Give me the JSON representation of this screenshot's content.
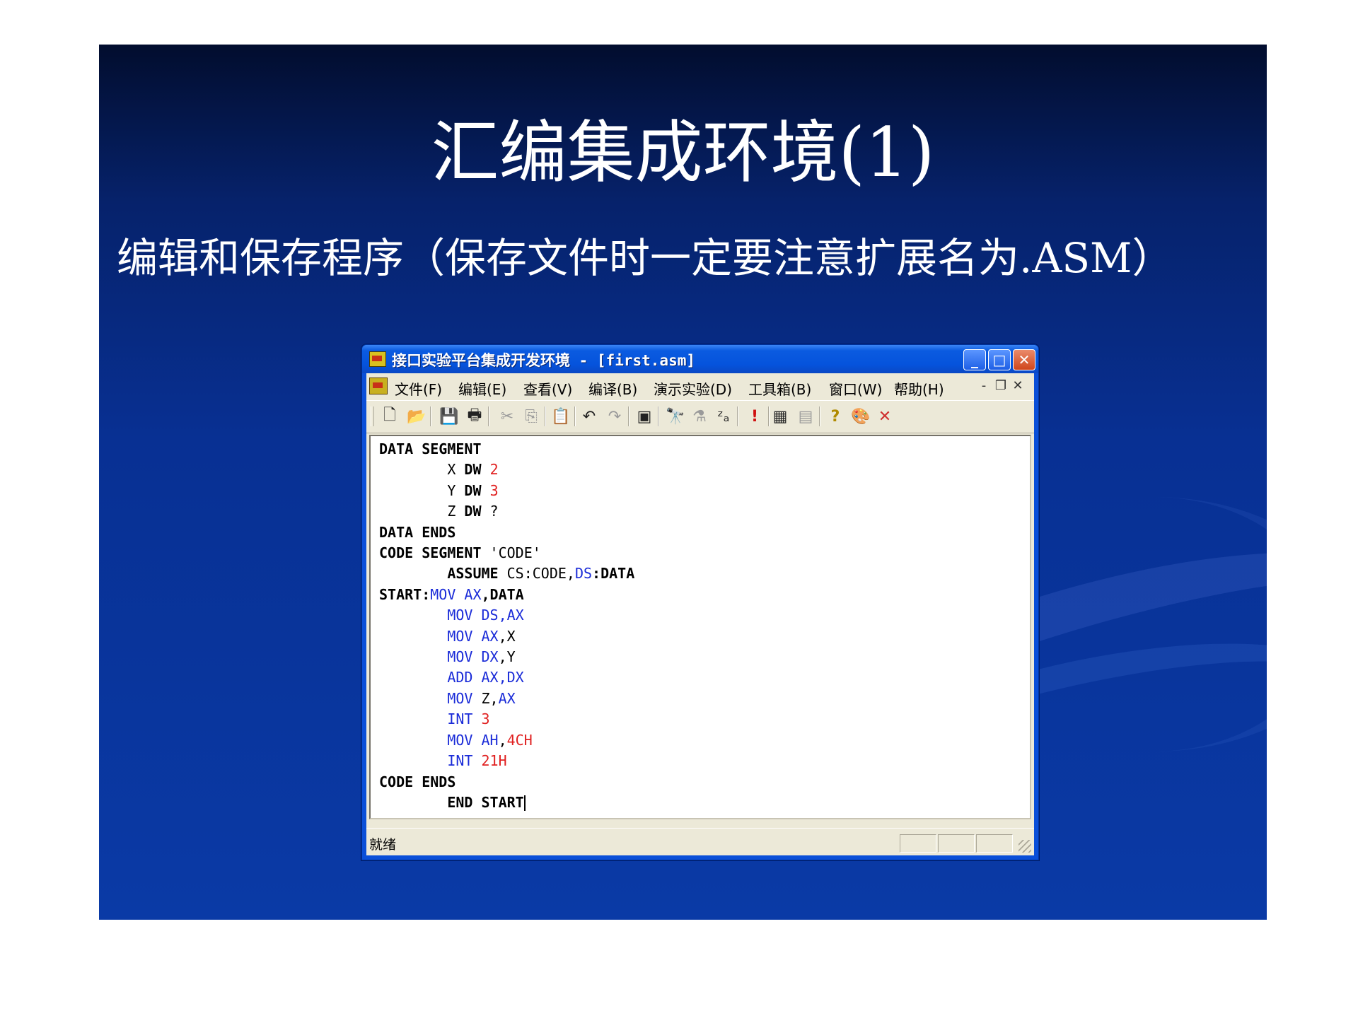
{
  "slide": {
    "title": "汇编集成环境(1)",
    "subtitle": "编辑和保存程序（保存文件时一定要注意扩展名为.ASM）"
  },
  "window": {
    "title": "接口实验平台集成开发环境 - [first.asm]",
    "controls": {
      "minimize": "_",
      "maximize": "□",
      "close": "✕"
    }
  },
  "menubar": {
    "items": [
      "文件(F)",
      "编辑(E)",
      "查看(V)",
      "编译(B)",
      "演示实验(D)",
      "工具箱(B)",
      "窗口(W)",
      "帮助(H)"
    ],
    "mdi_controls": {
      "minimize": "-",
      "restore": "❐",
      "close": "✕"
    }
  },
  "toolbar": {
    "buttons": [
      {
        "name": "new-file-icon",
        "glyph": "🗋",
        "enabled": true
      },
      {
        "name": "open-folder-icon",
        "glyph": "📂",
        "enabled": true
      },
      {
        "name": "save-icon",
        "glyph": "💾",
        "enabled": true
      },
      {
        "name": "print-icon",
        "glyph": "🖶",
        "enabled": true
      },
      {
        "name": "cut-icon",
        "glyph": "✂",
        "enabled": false
      },
      {
        "name": "copy-icon",
        "glyph": "⎘",
        "enabled": false
      },
      {
        "name": "paste-icon",
        "glyph": "📋",
        "enabled": true
      },
      {
        "name": "undo-icon",
        "glyph": "↶",
        "enabled": true
      },
      {
        "name": "redo-icon",
        "glyph": "↷",
        "enabled": false
      },
      {
        "name": "edit-window-icon",
        "glyph": "▣",
        "enabled": true
      },
      {
        "name": "find-binoculars-icon",
        "glyph": "🔭",
        "enabled": true
      },
      {
        "name": "replace-icon",
        "glyph": "⚗",
        "enabled": false
      },
      {
        "name": "sort-az-icon",
        "glyph": "ᶻₐ",
        "enabled": true
      },
      {
        "name": "run-exclamation-icon",
        "glyph": "!",
        "enabled": true
      },
      {
        "name": "debug-memory-icon",
        "glyph": "▦",
        "enabled": true
      },
      {
        "name": "list-icon",
        "glyph": "▤",
        "enabled": false
      },
      {
        "name": "help-icon",
        "glyph": "?",
        "enabled": true
      },
      {
        "name": "color-palette-icon",
        "glyph": "🎨",
        "enabled": true
      },
      {
        "name": "close-x-icon",
        "glyph": "✕",
        "enabled": true
      }
    ]
  },
  "editor": {
    "lines": [
      [
        {
          "t": "DATA SEGMENT",
          "c": "kw"
        }
      ],
      [
        {
          "t": "        X ",
          "c": ""
        },
        {
          "t": "DW",
          "c": "kw"
        },
        {
          "t": " ",
          "c": ""
        },
        {
          "t": "2",
          "c": "red"
        }
      ],
      [
        {
          "t": "        Y ",
          "c": ""
        },
        {
          "t": "DW",
          "c": "kw"
        },
        {
          "t": " ",
          "c": ""
        },
        {
          "t": "3",
          "c": "red"
        }
      ],
      [
        {
          "t": "        Z ",
          "c": ""
        },
        {
          "t": "DW",
          "c": "kw"
        },
        {
          "t": " ?",
          "c": ""
        }
      ],
      [
        {
          "t": "DATA ENDS",
          "c": "kw"
        }
      ],
      [
        {
          "t": "CODE SEGMENT ",
          "c": "kw"
        },
        {
          "t": "'CODE'",
          "c": ""
        }
      ],
      [
        {
          "t": "        ",
          "c": ""
        },
        {
          "t": "ASSUME",
          "c": "kw"
        },
        {
          "t": " CS:CODE,",
          "c": ""
        },
        {
          "t": "DS",
          "c": "blue"
        },
        {
          "t": ":DATA",
          "c": "kw"
        }
      ],
      [
        {
          "t": "START:",
          "c": "kw"
        },
        {
          "t": "MOV AX",
          "c": "blue"
        },
        {
          "t": ",DATA",
          "c": "kw"
        }
      ],
      [
        {
          "t": "        ",
          "c": ""
        },
        {
          "t": "MOV DS,AX",
          "c": "blue"
        }
      ],
      [
        {
          "t": "        ",
          "c": ""
        },
        {
          "t": "MOV AX",
          "c": "blue"
        },
        {
          "t": ",X",
          "c": ""
        }
      ],
      [
        {
          "t": "        ",
          "c": ""
        },
        {
          "t": "MOV DX",
          "c": "blue"
        },
        {
          "t": ",Y",
          "c": ""
        }
      ],
      [
        {
          "t": "        ",
          "c": ""
        },
        {
          "t": "ADD AX,DX",
          "c": "blue"
        }
      ],
      [
        {
          "t": "        ",
          "c": ""
        },
        {
          "t": "MOV",
          "c": "blue"
        },
        {
          "t": " Z,",
          "c": ""
        },
        {
          "t": "AX",
          "c": "blue"
        }
      ],
      [
        {
          "t": "        ",
          "c": ""
        },
        {
          "t": "INT",
          "c": "blue"
        },
        {
          "t": " ",
          "c": ""
        },
        {
          "t": "3",
          "c": "red"
        }
      ],
      [
        {
          "t": "        ",
          "c": ""
        },
        {
          "t": "MOV AH",
          "c": "blue"
        },
        {
          "t": ",",
          "c": ""
        },
        {
          "t": "4CH",
          "c": "red"
        }
      ],
      [
        {
          "t": "        ",
          "c": ""
        },
        {
          "t": "INT",
          "c": "blue"
        },
        {
          "t": " ",
          "c": ""
        },
        {
          "t": "21H",
          "c": "red"
        }
      ],
      [
        {
          "t": "CODE ENDS",
          "c": "kw"
        }
      ],
      [
        {
          "t": "        ",
          "c": ""
        },
        {
          "t": "END START",
          "c": "kw"
        },
        {
          "t": "",
          "c": "caret"
        }
      ]
    ]
  },
  "statusbar": {
    "text": "就绪"
  },
  "colors": {
    "keyword_blue": "#1a2bd8",
    "number_red": "#e02020",
    "xp_titlebar": "#0553dc"
  }
}
